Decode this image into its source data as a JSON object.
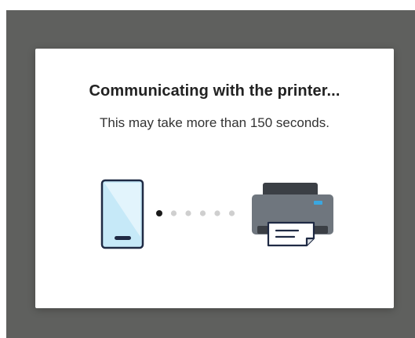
{
  "dialog": {
    "title": "Communicating with the printer...",
    "message": "This may take more than 150 seconds."
  },
  "illustration": {
    "icons": [
      "smartphone-icon",
      "printer-icon"
    ],
    "progress_dots": {
      "total": 6,
      "active_index": 0
    },
    "colors": {
      "phone_fill": "#c6e9f8",
      "phone_outline": "#1f2a44",
      "dot_active": "#1a1a1a",
      "dot_inactive": "#cfcfcf",
      "printer_top": "#3b3f45",
      "printer_body": "#6f767e",
      "printer_indicator": "#3aa7e0"
    }
  },
  "scrim": {
    "color": "#5f605e"
  }
}
